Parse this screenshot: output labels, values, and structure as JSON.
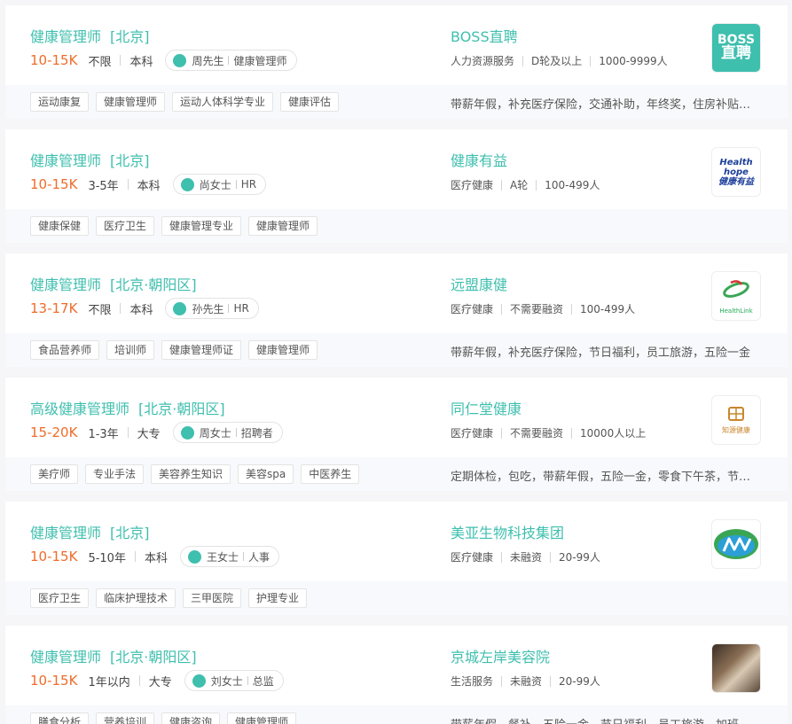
{
  "jobs": [
    {
      "title": "健康管理师",
      "location": "[北京]",
      "salary": "10-15K",
      "experience": "不限",
      "education": "本科",
      "recruiter_name": "周先生",
      "recruiter_title": "健康管理师",
      "company": "BOSS直聘",
      "industry": "人力资源服务",
      "funding": "D轮及以上",
      "size": "1000-9999人",
      "logo_text": [
        "BOSS",
        "直聘"
      ],
      "tags": [
        "运动康复",
        "健康管理师",
        "运动人体科学专业",
        "健康评估"
      ],
      "benefits": "带薪年假，补充医疗保险，交通补助，年终奖，住房补贴，员工旅游"
    },
    {
      "title": "健康管理师",
      "location": "[北京]",
      "salary": "10-15K",
      "experience": "3-5年",
      "education": "本科",
      "recruiter_name": "尚女士",
      "recruiter_title": "HR",
      "company": "健康有益",
      "industry": "医疗健康",
      "funding": "A轮",
      "size": "100-499人",
      "logo_text": [
        "Health hope",
        "健康有益"
      ],
      "tags": [
        "健康保健",
        "医疗卫生",
        "健康管理专业",
        "健康管理师"
      ],
      "benefits": ""
    },
    {
      "title": "健康管理师",
      "location": "[北京·朝阳区]",
      "salary": "13-17K",
      "experience": "不限",
      "education": "本科",
      "recruiter_name": "孙先生",
      "recruiter_title": "HR",
      "company": "远盟康健",
      "industry": "医疗健康",
      "funding": "不需要融资",
      "size": "100-499人",
      "logo_text": [
        "HealthLink"
      ],
      "tags": [
        "食品营养师",
        "培训师",
        "健康管理师证",
        "健康管理师"
      ],
      "benefits": "带薪年假，补充医疗保险，节日福利，员工旅游，五险一金"
    },
    {
      "title": "高级健康管理师",
      "location": "[北京·朝阳区]",
      "salary": "15-20K",
      "experience": "1-3年",
      "education": "大专",
      "recruiter_name": "周女士",
      "recruiter_title": "招聘者",
      "company": "同仁堂健康",
      "industry": "医疗健康",
      "funding": "不需要融资",
      "size": "10000人以上",
      "logo_text": [
        "知源健康"
      ],
      "tags": [
        "美疗师",
        "专业手法",
        "美容养生知识",
        "美容spa",
        "中医养生"
      ],
      "benefits": "定期体检，包吃，带薪年假，五险一金，零食下午茶，节日福利"
    },
    {
      "title": "健康管理师",
      "location": "[北京]",
      "salary": "10-15K",
      "experience": "5-10年",
      "education": "本科",
      "recruiter_name": "王女士",
      "recruiter_title": "人事",
      "company": "美亚生物科技集团",
      "industry": "医疗健康",
      "funding": "未融资",
      "size": "20-99人",
      "logo_text": [],
      "tags": [
        "医疗卫生",
        "临床护理技术",
        "三甲医院",
        "护理专业"
      ],
      "benefits": ""
    },
    {
      "title": "健康管理师",
      "location": "[北京·朝阳区]",
      "salary": "10-15K",
      "experience": "1年以内",
      "education": "大专",
      "recruiter_name": "刘女士",
      "recruiter_title": "总监",
      "company": "京城左岸美容院",
      "industry": "生活服务",
      "funding": "未融资",
      "size": "20-99人",
      "logo_text": [],
      "tags": [
        "膳食分析",
        "营养培训",
        "健康咨询",
        "健康管理师"
      ],
      "benefits": "带薪年假，餐补，五险一金，节日福利，员工旅游，加班补助"
    }
  ],
  "colors": {
    "accent": "#3fbfae",
    "salary": "#ef6c2a",
    "background": "#f6f6f8"
  }
}
